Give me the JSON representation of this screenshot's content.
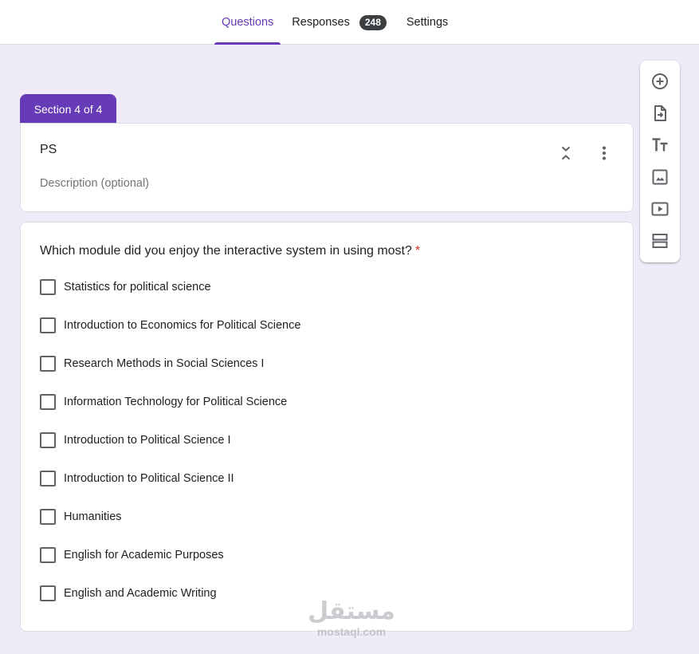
{
  "tabs": [
    {
      "label": "Questions",
      "active": true
    },
    {
      "label": "Responses",
      "badge": "248"
    },
    {
      "label": "Settings"
    }
  ],
  "section": {
    "tab_label": "Section 4 of 4",
    "title": "PS",
    "description_placeholder": "Description (optional)",
    "icons": [
      "collapse-icon",
      "more-vert-icon"
    ]
  },
  "question": {
    "title": "Which module did you enjoy the interactive system in using most?",
    "required_marker": "*",
    "options": [
      "Statistics for political science",
      "Introduction to Economics for Political Science",
      "Research Methods in Social Sciences I",
      "Information Technology for Political Science",
      "Introduction to Political Science I",
      "Introduction to Political Science II",
      "Humanities",
      "English for Academic Purposes",
      "English and Academic Writing"
    ]
  },
  "toolbar": {
    "tools": [
      "add-question-icon",
      "import-questions-icon",
      "add-title-icon",
      "add-image-icon",
      "add-video-icon",
      "add-section-icon"
    ]
  },
  "watermark": {
    "logo": "مستقل",
    "url": "mostaql.com"
  },
  "colors": {
    "accent": "#673ab7",
    "background": "#f0ebf8",
    "required": "#d93025",
    "badge": "#3c4043"
  }
}
